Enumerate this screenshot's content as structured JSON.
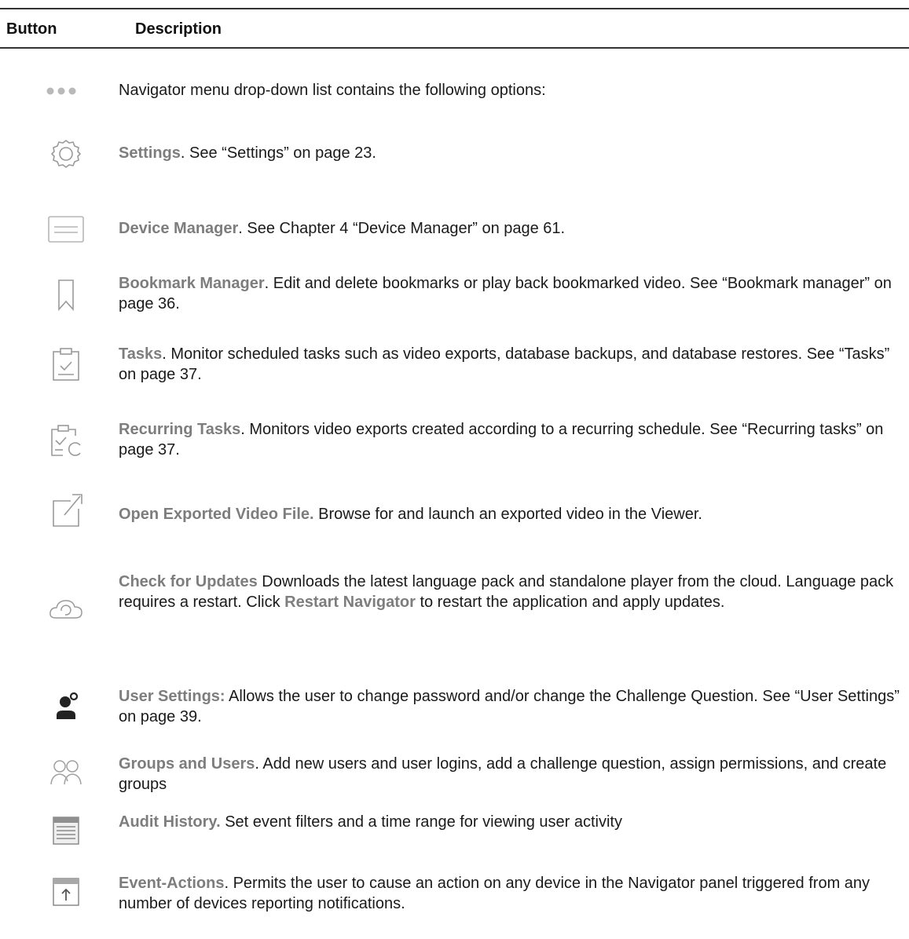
{
  "header": {
    "col_button": "Button",
    "col_description": "Description"
  },
  "rows": [
    {
      "icon": "more-dots-icon",
      "label": "",
      "text": "Navigator menu drop-down list contains the following options:"
    },
    {
      "icon": "gear-icon",
      "label": "Settings",
      "text": ". See “Settings” on page 23."
    },
    {
      "icon": "device-manager-icon",
      "label": "Device Manager",
      "text": ". See Chapter 4 “Device Manager” on page 61."
    },
    {
      "icon": "bookmark-icon",
      "label": "Bookmark Manager",
      "text": ". Edit and delete bookmarks or play back bookmarked video. See “Bookmark manager” on page 36."
    },
    {
      "icon": "clipboard-check-icon",
      "label": "Tasks",
      "text": ". Monitor scheduled tasks such as video exports, database backups, and database restores. See “Tasks” on page 37."
    },
    {
      "icon": "recurring-tasks-icon",
      "label": "Recurring Tasks",
      "text": ". Monitors video exports created according to a recurring schedule. See “Recurring tasks” on page 37."
    },
    {
      "icon": "open-external-icon",
      "label": "Open Exported Video File.",
      "text": " Browse for and launch an exported video in the Viewer."
    },
    {
      "icon": "cloud-refresh-icon",
      "label": "Check for Updates",
      "text": " Downloads the latest language pack and standalone player from the cloud. Language pack requires a restart. Click ",
      "label2": "Restart Navigator",
      "text2": " to restart the application and apply updates."
    },
    {
      "icon": "user-settings-icon",
      "label": "User Settings:",
      "text": " Allows the user to change password and/or change the Challenge Question. See “User Settings” on page 39."
    },
    {
      "icon": "users-group-icon",
      "label": "Groups and Users",
      "text": ". Add new users and user logins, add a challenge question, assign permissions, and create groups"
    },
    {
      "icon": "audit-history-icon",
      "label": "Audit History.",
      "text": " Set event filters and a time range for viewing user activity"
    },
    {
      "icon": "event-actions-icon",
      "label": "Event-Actions",
      "text": ". Permits the user to cause an action on any device in the Navigator panel triggered from any number of devices reporting notifications."
    }
  ]
}
